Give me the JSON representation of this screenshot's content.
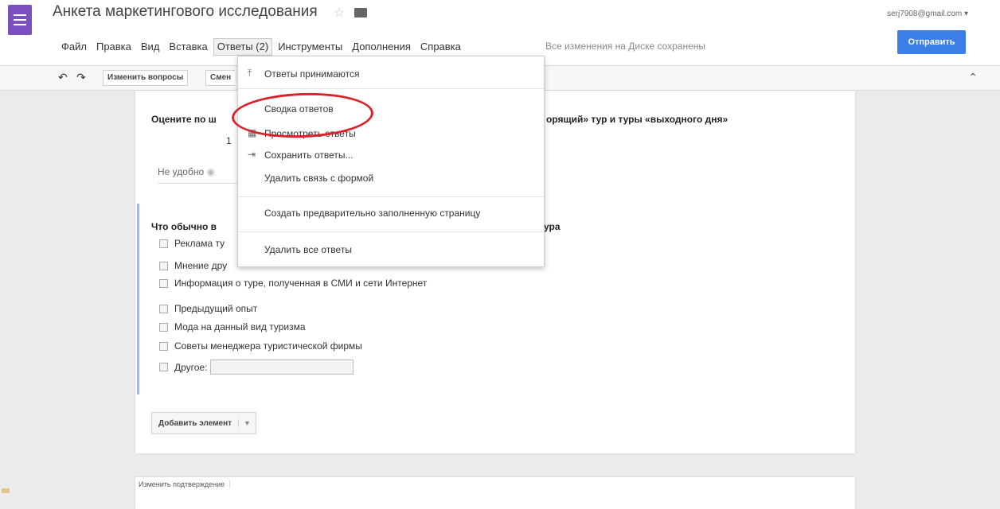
{
  "header": {
    "title": "Анкета маркетингового исследования",
    "account": "serj7908@gmail.com ▾",
    "send_label": "Отправить",
    "save_status": "Все изменения на Диске сохранены"
  },
  "menu": {
    "items": [
      {
        "label": "Файл"
      },
      {
        "label": "Правка"
      },
      {
        "label": "Вид"
      },
      {
        "label": "Вставка"
      },
      {
        "label": "Ответы (2)"
      },
      {
        "label": "Инструменты"
      },
      {
        "label": "Дополнения"
      },
      {
        "label": "Справка"
      }
    ]
  },
  "toolbar": {
    "edit_questions_label": "Изменить вопросы",
    "truncated_button_label": "Смен"
  },
  "dropdown": {
    "accepting": "Ответы принимаются",
    "summary": "Сводка ответов",
    "view": "Просмотреть ответы",
    "save": "Сохранить ответы...",
    "unlink": "Удалить связь с формой",
    "prefilled": "Создать предварительно заполненную страницу",
    "delete_all": "Удалить все ответы"
  },
  "form": {
    "q1_title_start": "Оцените по ш",
    "q1_title_end": "орящий» тур и туры «выходного дня»",
    "scale_number": "1",
    "scale_low": "Не удобно",
    "q2_title_start": "Что обычно в",
    "q2_title_end": "ура",
    "options": [
      "Реклама ту",
      "Мнение дру",
      "Информация о туре, полученная в СМИ и сети Интернет",
      "Предыдущий опыт",
      "Мода на данный вид туризма",
      "Советы менеджера туристической фирмы",
      "Другое:"
    ],
    "add_element_label": "Добавить элемент",
    "confirm_tab_label": "Изменить подтверждение"
  },
  "colors": {
    "app_icon": "#7a4fbf",
    "send_button": "#3b7ee8",
    "highlight": "#d9232b"
  }
}
